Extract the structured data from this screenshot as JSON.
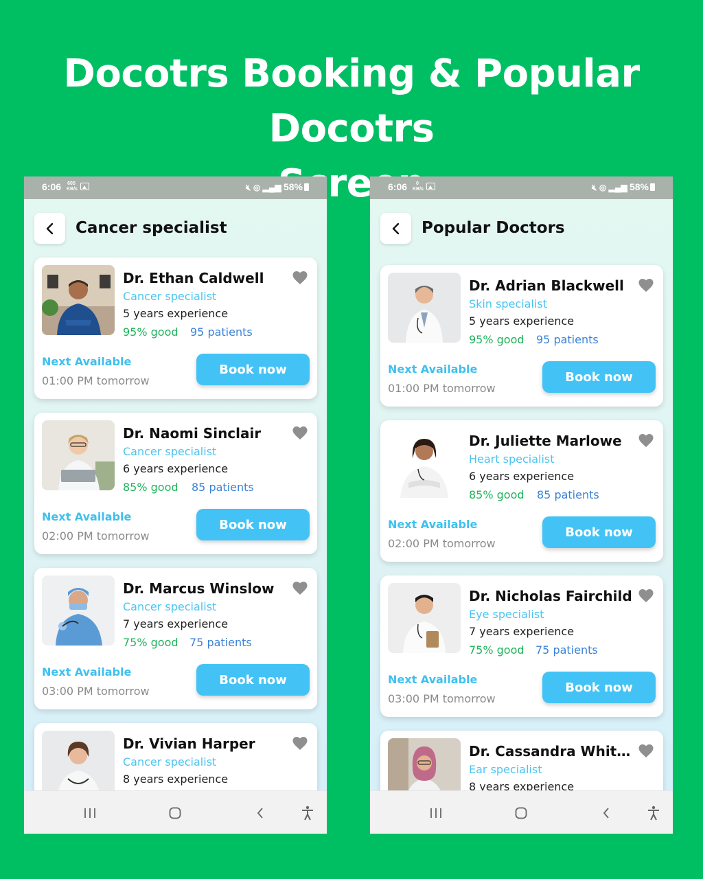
{
  "headline": {
    "line1": "Docotrs Booking & Popular Docotrs",
    "line2": "Screen"
  },
  "colors": {
    "background": "#00bf63",
    "accent": "#43c3f5",
    "specialty": "#4bc4ef",
    "rating": "#1db35a",
    "patients": "#3b82d6"
  },
  "screens": [
    {
      "status": {
        "time": "6:06",
        "netspeed": "605 KB/s",
        "battery": "58%"
      },
      "title": "Cancer specialist",
      "doctors": [
        {
          "name": "Dr. Ethan Caldwell",
          "specialty": "Cancer specialist",
          "experience": "5 years experience",
          "rating": "95% good",
          "patients": "95 patients",
          "next_label": "Next Available",
          "next_time": "01:00 PM tomorrow",
          "book": "Book now"
        },
        {
          "name": "Dr. Naomi Sinclair",
          "specialty": "Cancer specialist",
          "experience": "6 years experience",
          "rating": "85% good",
          "patients": "85 patients",
          "next_label": "Next Available",
          "next_time": "02:00 PM tomorrow",
          "book": "Book now"
        },
        {
          "name": "Dr. Marcus Winslow",
          "specialty": "Cancer specialist",
          "experience": "7 years experience",
          "rating": "75% good",
          "patients": "75 patients",
          "next_label": "Next Available",
          "next_time": "03:00 PM tomorrow",
          "book": "Book now"
        },
        {
          "name": "Dr. Vivian Harper",
          "specialty": "Cancer specialist",
          "experience": "8 years experience"
        }
      ]
    },
    {
      "status": {
        "time": "6:06",
        "netspeed": "0 KB/s",
        "battery": "58%"
      },
      "title": "Popular Doctors",
      "doctors": [
        {
          "name": "Dr. Adrian Blackwell",
          "specialty": "Skin specialist",
          "experience": "5 years experience",
          "rating": "95% good",
          "patients": "95 patients",
          "next_label": "Next Available",
          "next_time": "01:00 PM tomorrow",
          "book": "Book now"
        },
        {
          "name": "Dr. Juliette Marlowe",
          "specialty": "Heart specialist",
          "experience": "6 years experience",
          "rating": "85% good",
          "patients": "85 patients",
          "next_label": "Next Available",
          "next_time": "02:00 PM tomorrow",
          "book": "Book now"
        },
        {
          "name": "Dr. Nicholas Fairchild",
          "specialty": "Eye specialist",
          "experience": "7 years experience",
          "rating": "75% good",
          "patients": "75 patients",
          "next_label": "Next Available",
          "next_time": "03:00 PM tomorrow",
          "book": "Book now"
        },
        {
          "name": "Dr. Cassandra Whitm...",
          "specialty": "Ear specialist",
          "experience": "8 years experience"
        }
      ]
    }
  ]
}
